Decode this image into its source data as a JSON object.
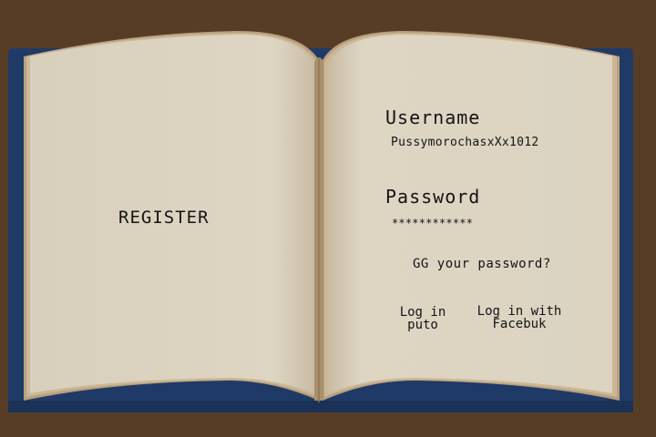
{
  "colors": {
    "background": "#583d26",
    "cover": "#1f3a66",
    "page": "#ded5c3",
    "page_edge": "#b59c7a",
    "text": "#141414"
  },
  "left_page": {
    "register_label": "REGISTER"
  },
  "right_page": {
    "username_label": "Username",
    "username_value": "PussymorochasxXx1012",
    "password_label": "Password",
    "password_value": "************",
    "forgot_label": "GG your password?",
    "login_button": {
      "line1": "Log in",
      "line2": "puto"
    },
    "facebook_button": {
      "line1": "Log in with",
      "line2": "Facebuk"
    }
  }
}
